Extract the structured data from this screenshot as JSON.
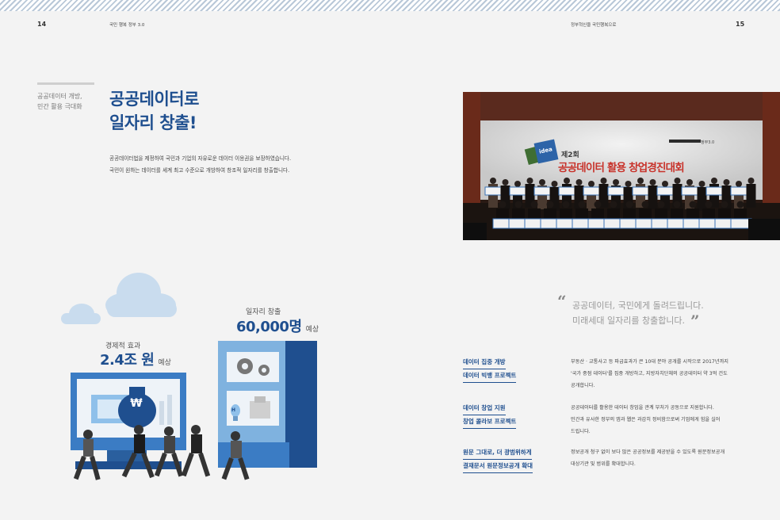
{
  "header": {
    "page_left": "14",
    "page_right": "15",
    "left_label": "국민 행복 정부 3.0",
    "right_label": "정부혁신을 국민행복으로"
  },
  "side": {
    "line1": "공공데이터 개방,",
    "line2": "민간 활용 극대화"
  },
  "title": {
    "line1": "공공데이터로",
    "line2": "일자리 창출!"
  },
  "description": {
    "line1": "공공데이터법을 제정하여 국민과 기업의 자유로운 데이터 이용권을 보장하였습니다.",
    "line2": "국민이 원하는 데이터를 세계 최고 수준으로 개방하여 창조적 일자리를 창출합니다."
  },
  "photo": {
    "banner_sub": "제2회",
    "banner_main": "공공데이터 활용 창업경진대회",
    "badge": "idea",
    "logo_text": "정부3.0"
  },
  "illustration": {
    "economic_label": "경제적 효과",
    "economic_value": "2.4조 원",
    "economic_suffix": "예상",
    "jobs_label": "일자리 창출",
    "jobs_value": "60,000명",
    "jobs_suffix": "예상",
    "coin_symbol": "₩",
    "bulb_letter": "H"
  },
  "quote": {
    "open_mark": "“",
    "close_mark": "”",
    "line1": "공공데이터, 국민에게 돌려드립니다.",
    "line2": "미래세대 일자리를 창출합니다."
  },
  "projects": [
    {
      "title1": "데이터 집중 개방",
      "title2": "데이터 빅뱅 프로젝트",
      "desc1": "부동산 · 교통사고 등 파급효과가 큰 10대 분야 공개를 시작으로 2017년까지",
      "desc2": "'국가 중점 데이터'를 집중 개방하고, 지방자치단체의 공공데이터 약 3억 건도",
      "desc3": "공개합니다."
    },
    {
      "title1": "데이터 창업 지원",
      "title2": "창업 콜라보 프로젝트",
      "desc1": "공공데이터를 활용한 데이터 창업을 관계 부처가 공동으로 지원합니다.",
      "desc2": "민간과 유사한 정부의 앱과 웹은 과감히 정비함으로써 기업에게 힘을 실어",
      "desc3": "드립니다."
    },
    {
      "title1": "원문 그대로, 더 광범위하게",
      "title2": "결재문서 원문정보공개 확대",
      "desc1": "정보공개 청구 없이 보다 많은 공공정보를 제공받을 수 있도록 원문정보공개",
      "desc2": "대상기관 및 범위를 확대합니다.",
      "desc3": ""
    }
  ],
  "colors": {
    "accent": "#1f4f8f",
    "light_blue": "#7fb2df",
    "mid_blue": "#3b7cc4",
    "cloud": "#c9dcee"
  }
}
